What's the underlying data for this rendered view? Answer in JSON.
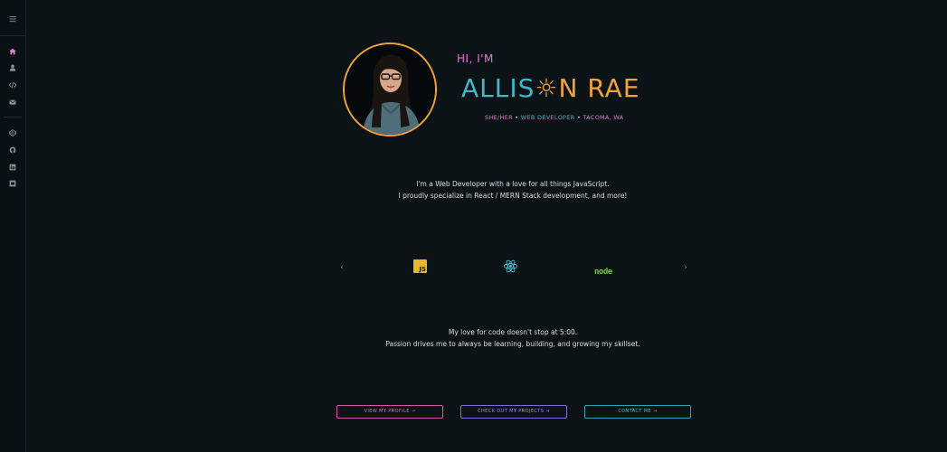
{
  "sidebar": {
    "items": [
      {
        "icon": "menu-icon"
      },
      {
        "icon": "home-icon"
      },
      {
        "icon": "user-icon"
      },
      {
        "icon": "code-icon"
      },
      {
        "icon": "mail-icon"
      },
      {
        "icon": "codepen-icon"
      },
      {
        "icon": "github-icon"
      },
      {
        "icon": "linkedin-icon"
      },
      {
        "icon": "devto-icon"
      }
    ],
    "active_color": "#e07bd0",
    "icon_color": "#8a9499"
  },
  "hero": {
    "greeting": "HI, I'M",
    "name_part1": "ALLIS",
    "name_part2": "N RAE",
    "name_sun": "☼",
    "tag_pronouns": "SHE/HER",
    "tag_sep1": " • ",
    "tag_role": "WEB DEVELOPER",
    "tag_sep2": " • ",
    "tag_location": "TACOMA, WA"
  },
  "intro": {
    "line1": "I'm a Web Developer with a love for all things JavaScript.",
    "line2": "I proudly specialize in React / MERN Stack development, and more!"
  },
  "carousel": {
    "prev": "‹",
    "next": "›",
    "js_label": "JS",
    "node_label": "node"
  },
  "passion": {
    "line1": "My love for code doesn't stop at 5:00.",
    "line2": "Passion drives me to always be learning, building, and growing my skillset."
  },
  "buttons": {
    "profile": "VIEW MY PROFILE →",
    "projects": "CHECK OUT MY PROJECTS →",
    "contact": "CONTACT ME →"
  },
  "colors": {
    "background": "#0b1317",
    "accent_orange": "#f3a23a",
    "accent_teal": "#3fb8c9",
    "accent_pink": "#e07bd0",
    "accent_purple": "#7c6fd0"
  }
}
